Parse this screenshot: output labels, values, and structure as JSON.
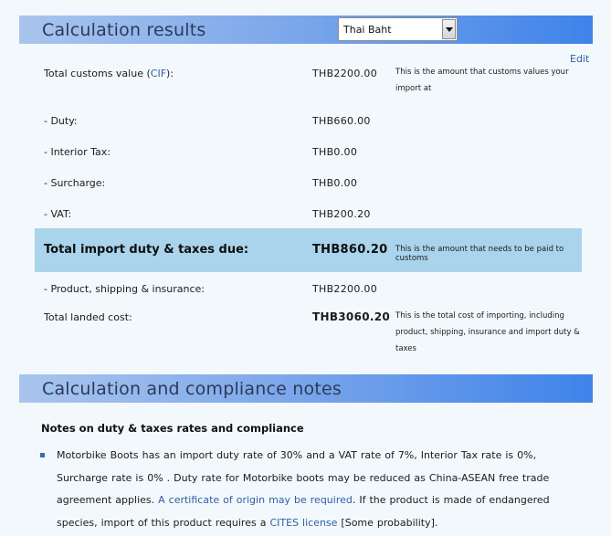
{
  "results_section": {
    "title": "Calculation results",
    "currency_select": {
      "selected": "Thai Baht"
    },
    "edit_label": "Edit"
  },
  "rows": {
    "customs_value": {
      "label_prefix": "Total customs value (",
      "label_link": "CIF",
      "label_suffix": "):",
      "value": "THB2200.00",
      "note": "This is the amount that customs values your import at"
    },
    "duty": {
      "label": "- Duty:",
      "value": "THB660.00"
    },
    "interior_tax": {
      "label": "- Interior Tax:",
      "value": "THB0.00"
    },
    "surcharge": {
      "label": "- Surcharge:",
      "value": "THB0.00"
    },
    "vat": {
      "label": "- VAT:",
      "value": "THB200.20"
    },
    "total_due": {
      "label": "Total import duty & taxes due:",
      "value": "THB860.20",
      "note": "This is the amount that needs to be paid to customs"
    },
    "product_shipping": {
      "label": "- Product, shipping & insurance:",
      "value": "THB2200.00"
    },
    "landed_cost": {
      "label": "Total landed cost:",
      "value": "THB3060.20",
      "note": "This is the total cost of importing, including product, shipping, insurance and import duty & taxes"
    }
  },
  "notes_section": {
    "title": "Calculation and compliance notes",
    "heading": "Notes on duty & taxes rates and compliance",
    "note_part1": "Motorbike Boots has an import duty rate of 30% and a VAT rate of 7%, Interior Tax rate is 0%, Surcharge rate is 0% . Duty rate for Motorbike boots may be reduced as China-ASEAN free trade agreement applies. ",
    "certificate_link": "A certificate of origin may be required",
    "note_part2": ". If the product is made of endangered species, import of this product requires a ",
    "cites_link": "CITES license",
    "note_part3": " [Some probability]."
  }
}
